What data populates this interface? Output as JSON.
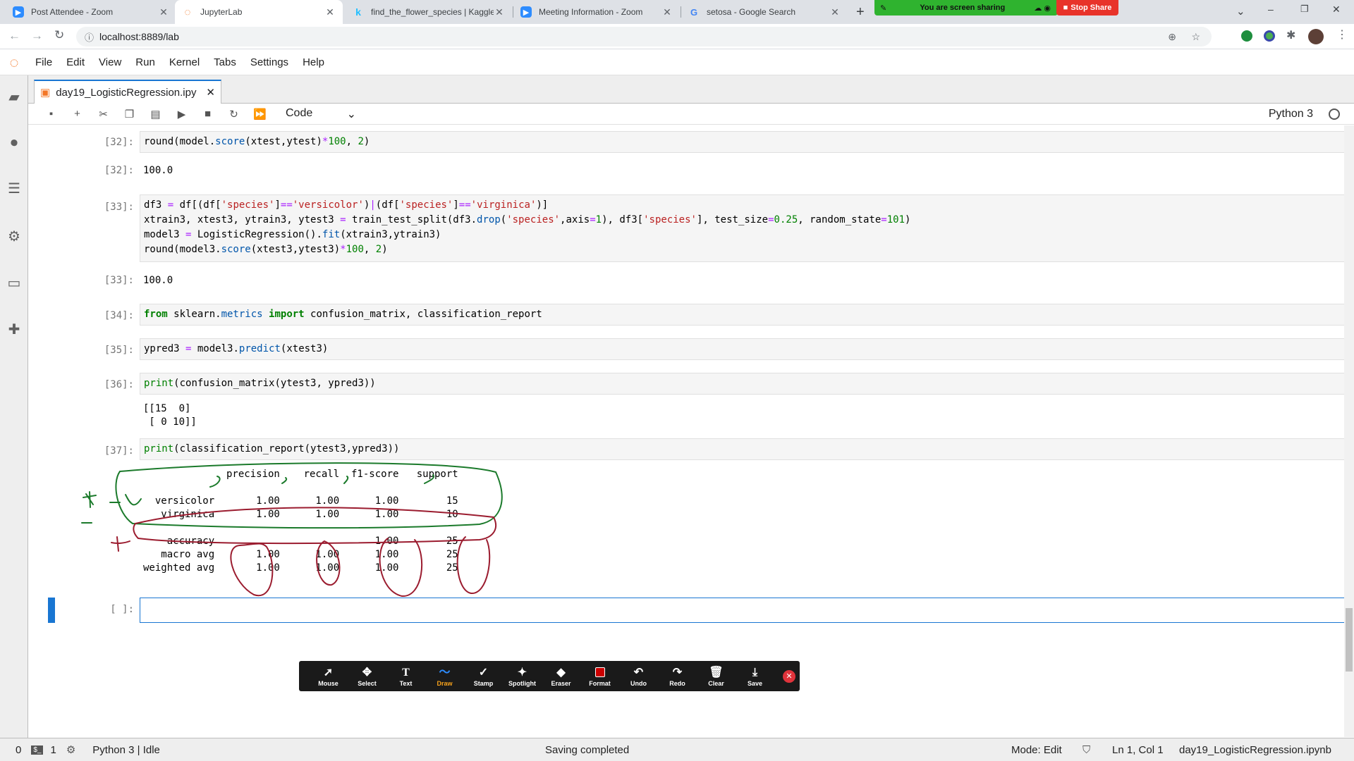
{
  "browser": {
    "tabs": [
      {
        "title": "Post Attendee - Zoom",
        "icon": "zoom-icon"
      },
      {
        "title": "JupyterLab",
        "icon": "jupyter-icon"
      },
      {
        "title": "find_the_flower_species | Kaggle",
        "icon": "kaggle-icon"
      },
      {
        "title": "Meeting Information - Zoom",
        "icon": "zoom-icon"
      },
      {
        "title": "setosa - Google Search",
        "icon": "google-icon"
      }
    ],
    "url": "localhost:8889/lab",
    "share_banner": "You are screen sharing",
    "stop_share": "Stop Share"
  },
  "menu": [
    "File",
    "Edit",
    "View",
    "Run",
    "Kernel",
    "Tabs",
    "Settings",
    "Help"
  ],
  "notebook": {
    "tab_title": "day19_LogisticRegression.ipy",
    "cell_type": "Code",
    "kernel": "Python 3",
    "prompts": {
      "p32": "[32]:",
      "p33": "[33]:",
      "p34": "[34]:",
      "p35": "[35]:",
      "p36": "[36]:",
      "p37": "[37]:",
      "pempty": "[ ]:"
    },
    "outputs": {
      "o32": "100.0",
      "o33": "100.0",
      "o36": "[[15  0]\n [ 0 10]]",
      "o37": "              precision    recall  f1-score   support\n\n  versicolor       1.00      1.00      1.00        15\n   virginica       1.00      1.00      1.00        10\n\n    accuracy                           1.00        25\n   macro avg       1.00      1.00      1.00        25\nweighted avg       1.00      1.00      1.00        25"
    }
  },
  "zoom_toolbar": [
    "Mouse",
    "Select",
    "Text",
    "Draw",
    "Stamp",
    "Spotlight",
    "Eraser",
    "Format",
    "Undo",
    "Redo",
    "Clear",
    "Save"
  ],
  "status": {
    "left_num": "0",
    "terminals": "1",
    "kernel_state": "Python 3 | Idle",
    "message": "Saving completed",
    "mode": "Mode: Edit",
    "cursor": "Ln 1, Col 1",
    "file": "day19_LogisticRegression.ipynb"
  }
}
